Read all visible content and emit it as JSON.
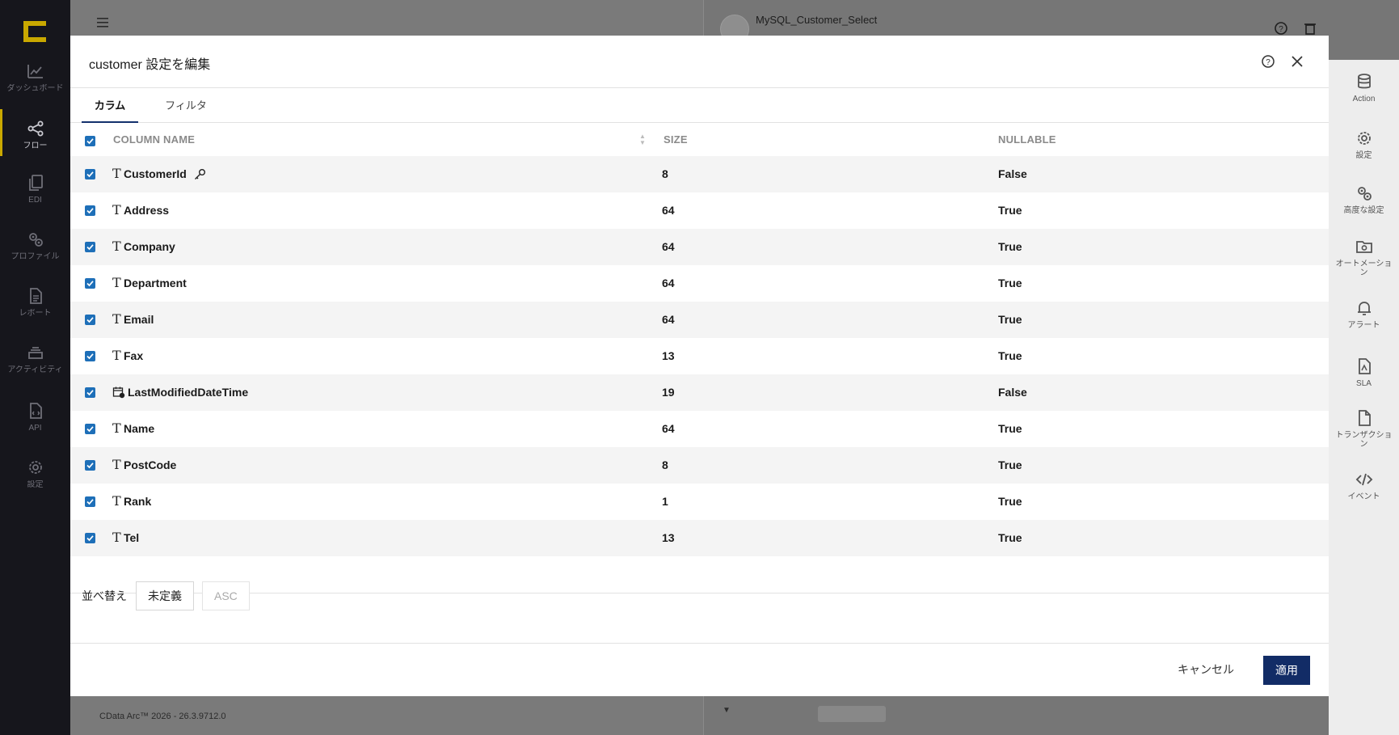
{
  "leftnav": {
    "items": [
      {
        "label": "ダッシュボード",
        "icon": "chart-line-icon",
        "active": false
      },
      {
        "label": "フロー",
        "icon": "share-nodes-icon",
        "active": true
      },
      {
        "label": "EDI",
        "icon": "documents-icon",
        "active": false
      },
      {
        "label": "プロファイル",
        "icon": "gears-icon",
        "active": false
      },
      {
        "label": "レポート",
        "icon": "report-icon",
        "active": false
      },
      {
        "label": "アクティビティ",
        "icon": "stack-icon",
        "active": false
      },
      {
        "label": "API",
        "icon": "api-file-icon",
        "active": false
      },
      {
        "label": "設定",
        "icon": "gear-icon",
        "active": false
      }
    ]
  },
  "background": {
    "panel_title": "MySQL_Customer_Select",
    "footer": "CData Arc™ 2026 - 26.3.9712.0"
  },
  "rightrail": {
    "items": [
      {
        "label": "Action",
        "icon": "database-icon"
      },
      {
        "label": "設定",
        "icon": "gear-icon"
      },
      {
        "label": "高度な設定",
        "icon": "gears-icon"
      },
      {
        "label": "オートメーション",
        "icon": "folder-gear-icon"
      },
      {
        "label": "アラート",
        "icon": "bell-icon"
      },
      {
        "label": "SLA",
        "icon": "sla-file-icon"
      },
      {
        "label": "トランザクション",
        "icon": "file-icon"
      },
      {
        "label": "イベント",
        "icon": "code-icon"
      }
    ]
  },
  "modal": {
    "title": "customer 設定を編集",
    "tabs": [
      {
        "label": "カラム",
        "active": true
      },
      {
        "label": "フィルタ",
        "active": false
      }
    ],
    "columns": {
      "name": "COLUMN NAME",
      "size": "SIZE",
      "nullable": "NULLABLE"
    },
    "rows": [
      {
        "name": "CustomerId",
        "type": "text",
        "key": true,
        "size": "8",
        "nullable": "False"
      },
      {
        "name": "Address",
        "type": "text",
        "key": false,
        "size": "64",
        "nullable": "True"
      },
      {
        "name": "Company",
        "type": "text",
        "key": false,
        "size": "64",
        "nullable": "True"
      },
      {
        "name": "Department",
        "type": "text",
        "key": false,
        "size": "64",
        "nullable": "True"
      },
      {
        "name": "Email",
        "type": "text",
        "key": false,
        "size": "64",
        "nullable": "True"
      },
      {
        "name": "Fax",
        "type": "text",
        "key": false,
        "size": "13",
        "nullable": "True"
      },
      {
        "name": "LastModifiedDateTime",
        "type": "datetime",
        "key": false,
        "size": "19",
        "nullable": "False"
      },
      {
        "name": "Name",
        "type": "text",
        "key": false,
        "size": "64",
        "nullable": "True"
      },
      {
        "name": "PostCode",
        "type": "text",
        "key": false,
        "size": "8",
        "nullable": "True"
      },
      {
        "name": "Rank",
        "type": "text",
        "key": false,
        "size": "1",
        "nullable": "True"
      },
      {
        "name": "Tel",
        "type": "text",
        "key": false,
        "size": "13",
        "nullable": "True"
      }
    ],
    "sort": {
      "label": "並べ替え",
      "selected": "未定義",
      "disabled": "ASC"
    },
    "cancel_label": "キャンセル",
    "apply_label": "適用"
  },
  "colors": {
    "primary": "#122c66",
    "checkbox": "#1e6fb8",
    "nav_bg": "#16161c",
    "nav_accent": "#c9a800"
  }
}
